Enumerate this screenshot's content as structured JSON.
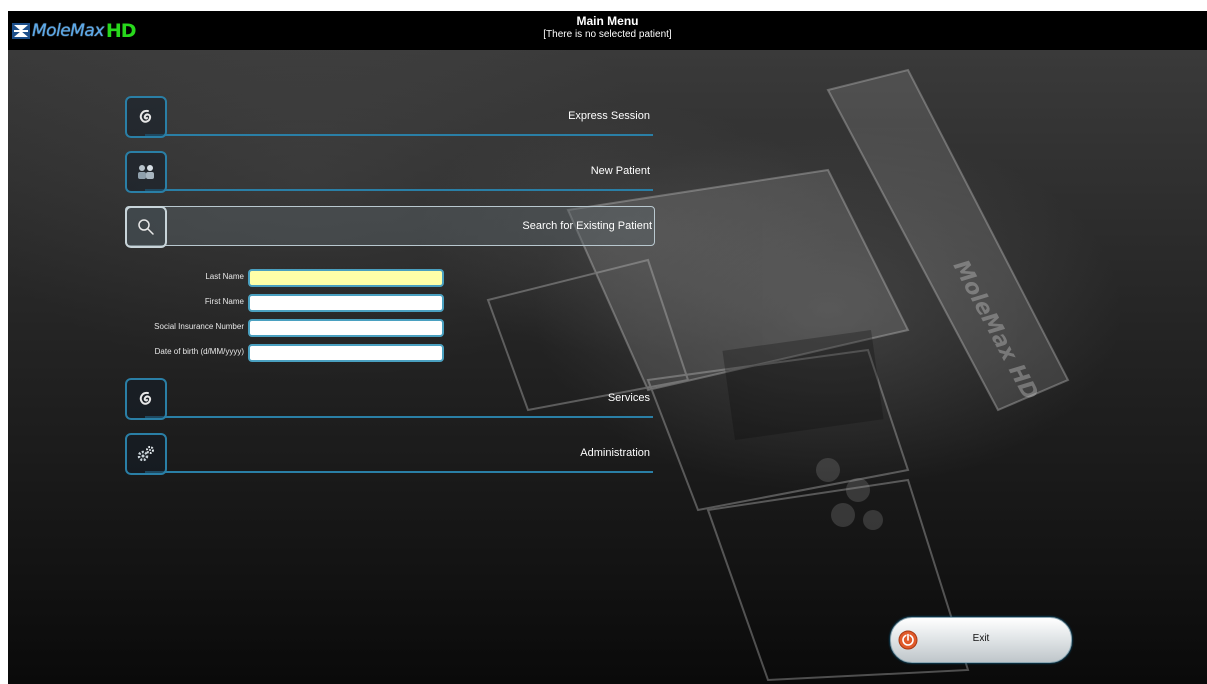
{
  "header": {
    "logo_text": "MoleMax",
    "logo_hd": "HD",
    "title": "Main Menu",
    "subtitle": "[There is no selected patient]"
  },
  "menu": {
    "express": "Express Session",
    "new_patient": "New Patient",
    "search": "Search for Existing Patient",
    "services": "Services",
    "administration": "Administration"
  },
  "search_form": {
    "last_name_label": "Last Name",
    "last_name_value": "",
    "first_name_label": "First Name",
    "first_name_value": "",
    "sin_label": "Social Insurance Number",
    "sin_value": "",
    "dob_label": "Date of birth (d/MM/yyyy)",
    "dob_value": ""
  },
  "exit_label": "Exit",
  "background_watermark": "MoleMax HD",
  "colors": {
    "accent": "#2a7fa6",
    "active_field": "#ffffa8",
    "exit_icon": "#e05a2a",
    "logo_hd": "#28d81c"
  },
  "icons": {
    "express": "swirl-icon",
    "new_patient": "users-icon",
    "search": "search-icon",
    "services": "swirl-icon",
    "administration": "gears-icon",
    "exit": "power-icon"
  }
}
